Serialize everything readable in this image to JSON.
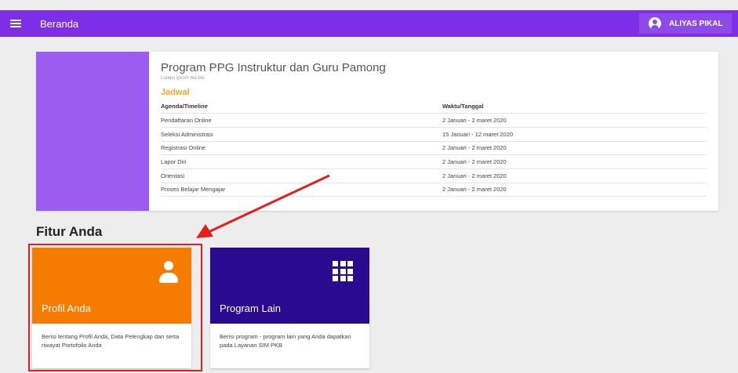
{
  "topbar": {
    "title": "Beranda",
    "user_name": "ALIYAS PIKAL",
    "menu_icon": "hamburger-menu-icon",
    "avatar_icon": "account-circle-icon"
  },
  "program": {
    "title": "Program PPG Instruktur dan Guru Pamong",
    "subtitle": "Loreps ipsum bla bla",
    "schedule_heading": "Jadwal",
    "columns": [
      "Agenda/Timeline",
      "Waktu/Tanggal"
    ],
    "rows": [
      {
        "agenda": "Pendaftaran Online",
        "date": "2 Januari - 2 maret 2020"
      },
      {
        "agenda": "Seleksi Administrasi",
        "date": "15 Januari - 12 maret 2020"
      },
      {
        "agenda": "Registrasi Online",
        "date": "2 Januari - 2 maret 2020"
      },
      {
        "agenda": "Lapor Diri",
        "date": "2 Januari - 2 maret 2020"
      },
      {
        "agenda": "Orientasi",
        "date": "2 Januari - 2 maret 2020"
      },
      {
        "agenda": "Proses Belajar Mengajar",
        "date": "2 Januari - 2 maret 2020"
      }
    ]
  },
  "features": {
    "heading": "Fitur Anda",
    "cards": [
      {
        "title": "Profil Anda",
        "description": "Berisi tentang Profil Anda, Data Pelengkap dan serta riwayat Portofoilo Anda",
        "color": "#f57c00",
        "icon": "person-icon"
      },
      {
        "title": "Program Lain",
        "description": "Berisi program - program lain yang Anda dapatkan pada Layanan SIM PKB",
        "color": "#2a0a8f",
        "icon": "apps-grid-icon"
      }
    ]
  },
  "colors": {
    "topbar": "#7c2fe6",
    "program_stripe": "#9d5cf0",
    "jadwal": "#f5a623",
    "annotation": "#e21e1e"
  }
}
